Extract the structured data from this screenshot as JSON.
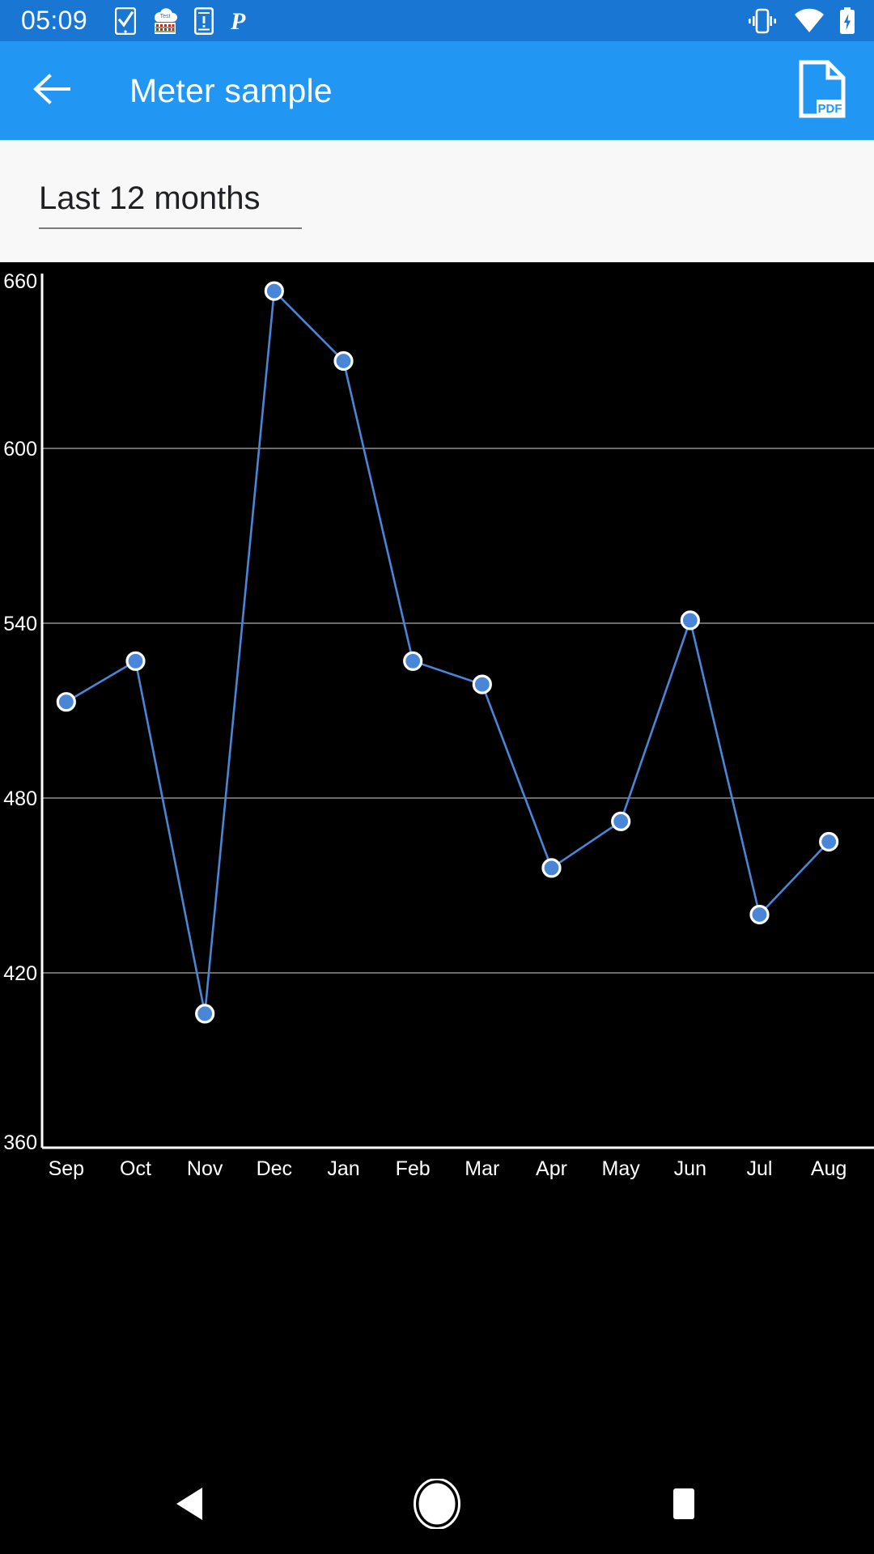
{
  "status_bar": {
    "clock": "05:09",
    "background": "#1976d2",
    "left_icons": [
      "task-check-phone-icon",
      "test-sim-card-icon",
      "phone-alert-icon",
      "parking-p-icon"
    ],
    "right_icons": [
      "vibrate-icon",
      "wifi-icon",
      "battery-charging-icon"
    ]
  },
  "app_bar": {
    "background": "#2196f3",
    "title": "Meter sample",
    "back_icon": "arrow-left-icon",
    "action_icon": "pdf-document-icon",
    "action_label": "PDF"
  },
  "selector": {
    "value": "Last 12 months",
    "options": [
      "Last 12 months"
    ]
  },
  "nav_bar": {
    "back_icon": "triangle-back-icon",
    "home_icon": "circle-home-icon",
    "recents_icon": "square-recents-icon"
  },
  "chart_data": {
    "type": "line",
    "title": "",
    "subtitle": "",
    "xlabel": "",
    "ylabel": "",
    "background": "#000000",
    "line_color": "#4a86d8",
    "marker_fill": "#4a86d8",
    "marker_stroke": "#ffffff",
    "grid": true,
    "grid_color": "#6b6b6b",
    "axis_color": "#ffffff",
    "legend": null,
    "ylim": [
      360,
      660
    ],
    "yticks": [
      360,
      420,
      480,
      540,
      600,
      660
    ],
    "ytick_labels": [
      "360",
      "420",
      "480",
      "540",
      "600",
      "660"
    ],
    "categories": [
      "Sep",
      "Oct",
      "Nov",
      "Dec",
      "Jan",
      "Feb",
      "Mar",
      "Apr",
      "May",
      "Jun",
      "Jul",
      "Aug"
    ],
    "values": [
      513,
      527,
      406,
      654,
      630,
      527,
      519,
      456,
      472,
      541,
      440,
      465
    ]
  }
}
